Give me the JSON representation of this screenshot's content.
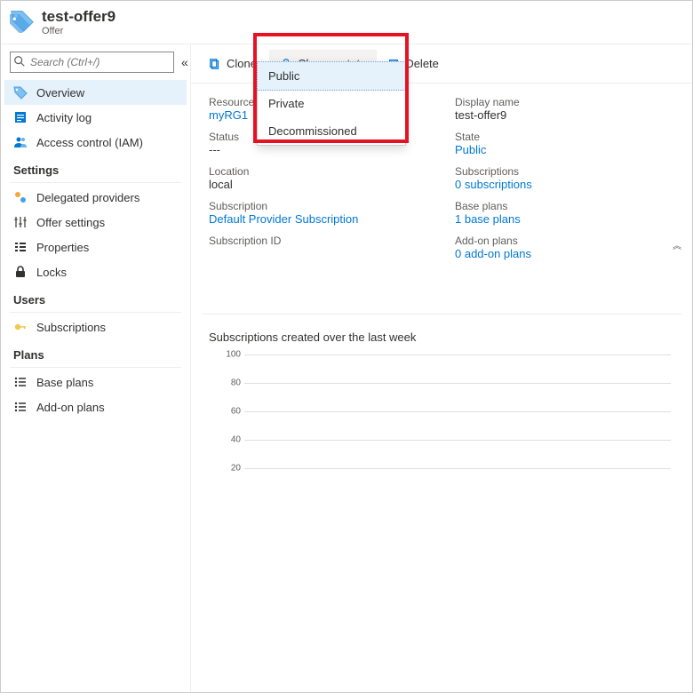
{
  "header": {
    "title": "test-offer9",
    "subtitle": "Offer"
  },
  "search": {
    "placeholder": "Search (Ctrl+/)"
  },
  "sidebar": {
    "items": [
      {
        "label": "Overview"
      },
      {
        "label": "Activity log"
      },
      {
        "label": "Access control (IAM)"
      }
    ],
    "settings_head": "Settings",
    "settings": [
      {
        "label": "Delegated providers"
      },
      {
        "label": "Offer settings"
      },
      {
        "label": "Properties"
      },
      {
        "label": "Locks"
      }
    ],
    "users_head": "Users",
    "users": [
      {
        "label": "Subscriptions"
      }
    ],
    "plans_head": "Plans",
    "plans": [
      {
        "label": "Base plans"
      },
      {
        "label": "Add-on plans"
      }
    ]
  },
  "toolbar": {
    "clone": "Clone",
    "change_state": "Change state",
    "delete": "Delete"
  },
  "dropdown": {
    "public": "Public",
    "private": "Private",
    "decommissioned": "Decommissioned"
  },
  "details": {
    "left": {
      "resource_group_label": "Resource group",
      "resource_group_value": "myRG1",
      "status_label": "Status",
      "status_value": "---",
      "location_label": "Location",
      "location_value": "local",
      "subscription_label": "Subscription",
      "subscription_value": "Default Provider Subscription",
      "subscription_id_label": "Subscription ID"
    },
    "right": {
      "display_name_label": "Display name",
      "display_name_value": "test-offer9",
      "state_label": "State",
      "state_value": "Public",
      "subscriptions_label": "Subscriptions",
      "subscriptions_value": "0 subscriptions",
      "base_plans_label": "Base plans",
      "base_plans_value": "1 base plans",
      "addon_plans_label": "Add-on plans",
      "addon_plans_value": "0 add-on plans"
    }
  },
  "chart": {
    "title": "Subscriptions created over the last week"
  },
  "chart_data": {
    "type": "line",
    "title": "Subscriptions created over the last week",
    "xlabel": "",
    "ylabel": "",
    "ylim": [
      0,
      100
    ],
    "yticks": [
      20,
      40,
      60,
      80,
      100
    ],
    "categories": [],
    "values": []
  }
}
